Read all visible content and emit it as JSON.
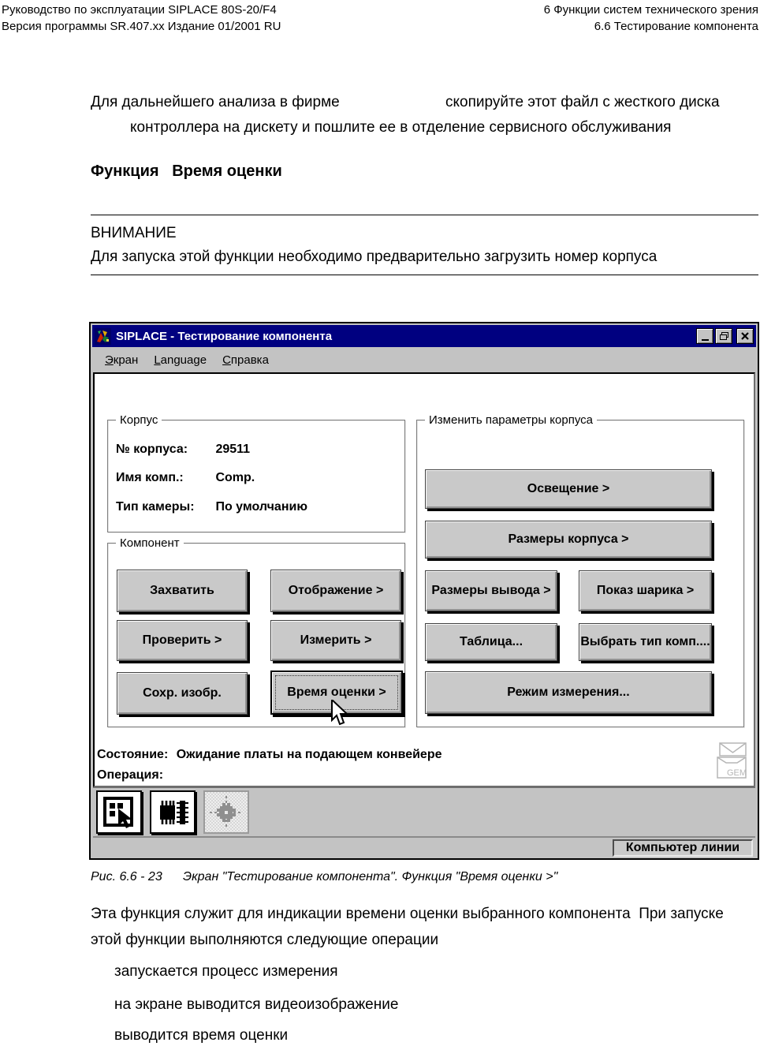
{
  "doc": {
    "header": {
      "left_line1": "Руководство по эксплуатации SIPLACE 80S-20/F4",
      "left_line2": "Версия программы SR.407.xx  Издание 01/2001 RU",
      "right_line1": "6 Функции систем технического зрения",
      "right_line2": "6.6 Тестирование компонента"
    },
    "intro": {
      "line1_left": "Для дальнейшего анализа в фирме",
      "line1_right": "скопируйте этот файл с жесткого диска",
      "line2": "контроллера на дискету и пошлите ее в отделение сервисного обслуживания"
    },
    "heading": "Функция   Время оценки",
    "warning": {
      "title": "ВНИМАНИЕ",
      "text": "Для запуска этой функции необходимо предварительно загрузить номер корпуса"
    },
    "caption": {
      "label": "Рис. 6.6 - 23",
      "text": "Экран \"Тестирование компонента\". Функция \"Время оценки >\""
    },
    "body": {
      "para_line1": "Эта функция служит для индикации времени оценки выбранного компонента  При запуске",
      "para_line2": "этой функции выполняются следующие операции",
      "list": [
        "запускается процесс измерения",
        "на экране выводится видеоизображение",
        "выводится время оценки"
      ]
    }
  },
  "dialog": {
    "title": "SIPLACE - Тестирование компонента",
    "window_controls": [
      "minimize",
      "restore",
      "close"
    ],
    "menu": [
      "Экран",
      "Language",
      "Справка"
    ],
    "korpus": {
      "title": "Корпус",
      "rows": [
        {
          "label": "№ корпуса:",
          "value": "29511"
        },
        {
          "label": "Имя комп.:",
          "value": "Comp."
        },
        {
          "label": "Тип камеры:",
          "value": "По умолчанию"
        }
      ]
    },
    "component_group": {
      "title": "Компонент",
      "buttons": [
        "Захватить",
        "Отображение >",
        "Проверить >",
        "Измерить >",
        "Сохр. изобр.",
        "Время оценки >"
      ]
    },
    "params_group": {
      "title": "Изменить параметры корпуса",
      "buttons": [
        "Освещение >",
        "Размеры корпуса >",
        "Размеры вывода >",
        "Показ шарика >",
        "Таблица...",
        "Выбрать тип комп....",
        "Режим измерения..."
      ]
    },
    "status": {
      "state_label": "Состояние:",
      "state_value": "Ожидание платы на подающем конвейере",
      "operation_label": "Операция:",
      "gem_label": "GEM"
    },
    "statusbar_panel": "Компьютер линии",
    "colors": {
      "titlebar": "#000080",
      "chrome": "#c3c3c3"
    },
    "icons": [
      "app-icon",
      "select-component-icon",
      "components-icon",
      "measure-position-icon",
      "gem-envelope-icon",
      "mouse-cursor-icon"
    ]
  }
}
